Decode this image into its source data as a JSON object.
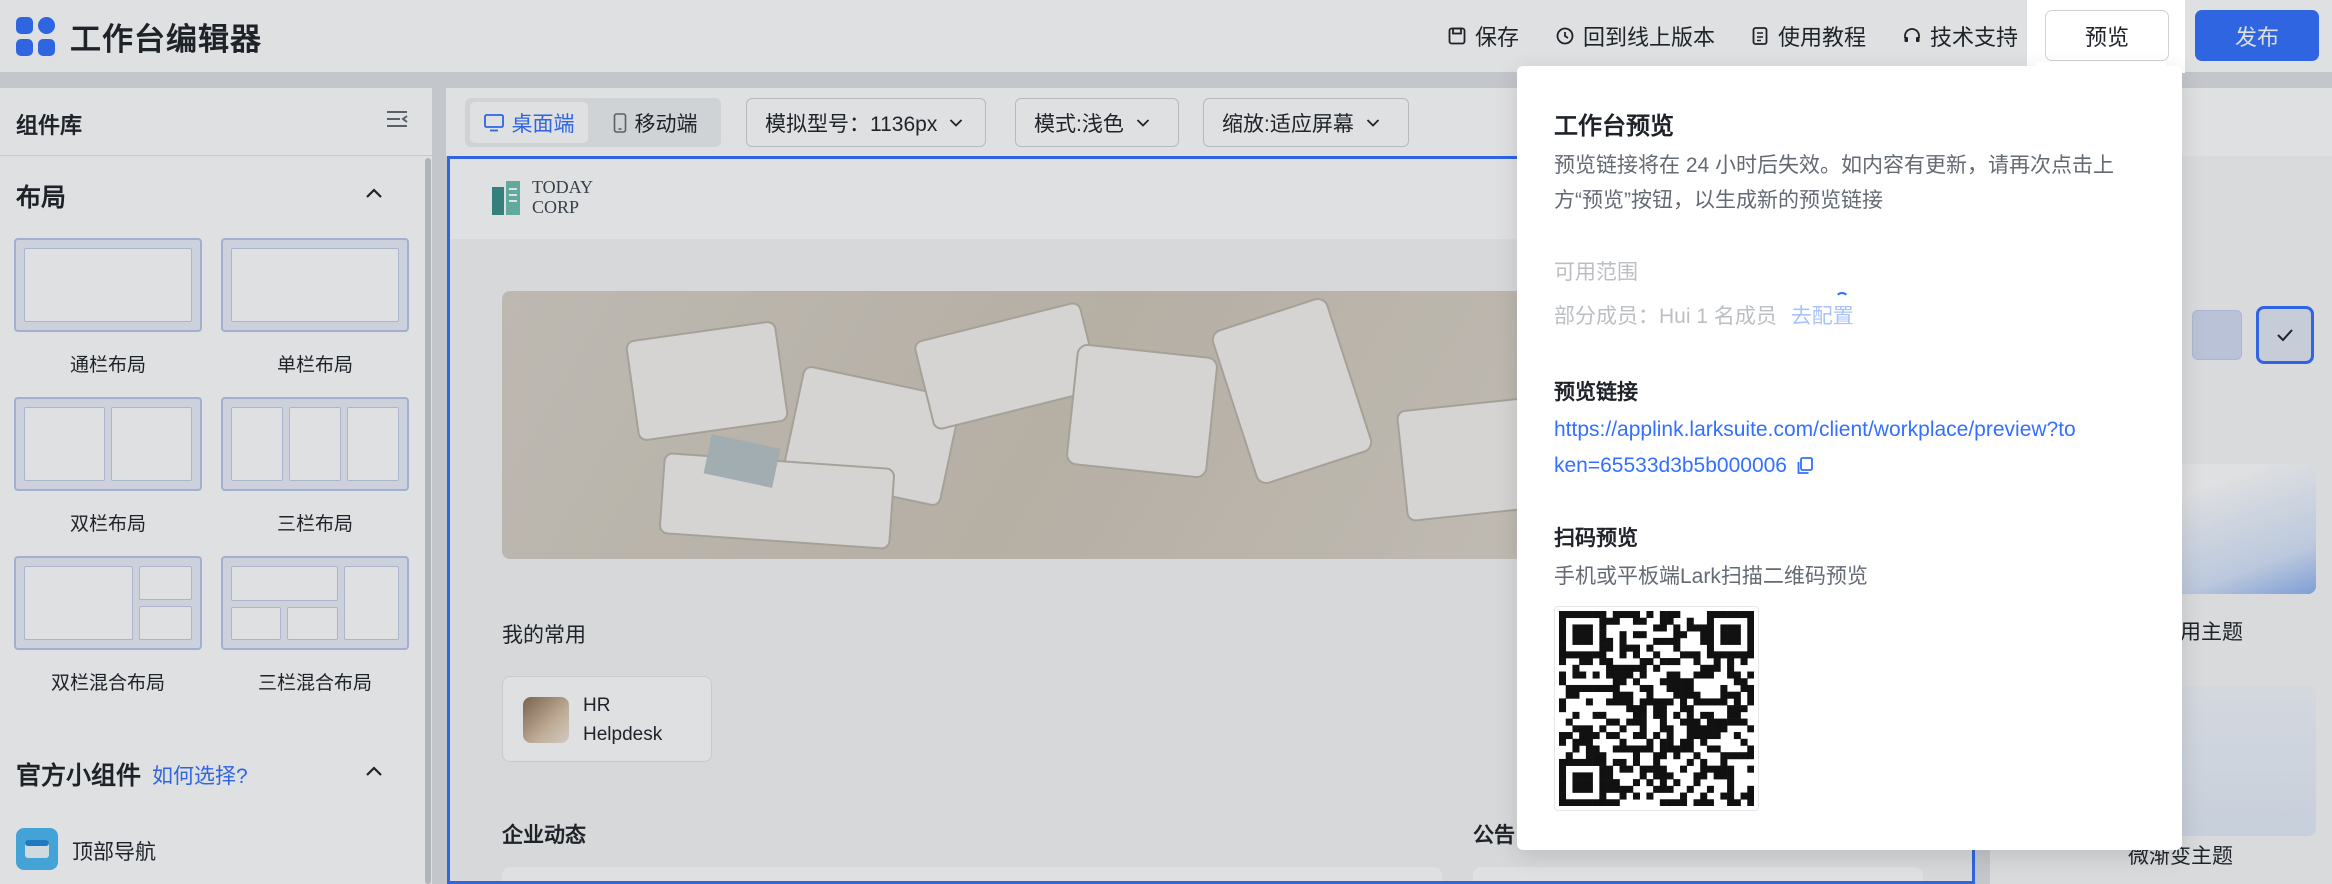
{
  "app": {
    "title": "工作台编辑器"
  },
  "toolbar": {
    "save": "保存",
    "revert": "回到线上版本",
    "tutorial": "使用教程",
    "support": "技术支持",
    "preview": "预览",
    "publish": "发布"
  },
  "left_panel": {
    "title": "组件库",
    "layout_section": "布局",
    "layouts": [
      "通栏布局",
      "单栏布局",
      "双栏布局",
      "三栏布局",
      "双栏混合布局",
      "三栏混合布局"
    ],
    "widgets_section": "官方小组件",
    "widgets_help": "如何选择?",
    "widgets": [
      "顶部导航"
    ]
  },
  "canvas_toolbar": {
    "desktop": "桌面端",
    "mobile": "移动端",
    "model": "模拟型号：1136px",
    "mode": "模式:浅色",
    "zoom": "缩放:适应屏幕"
  },
  "canvas": {
    "logo_line1": "TODAY",
    "logo_line2": "CORP",
    "favorites_title": "我的常用",
    "app_name_1": "HR",
    "app_name_2": "Helpdesk",
    "news_title": "企业动态",
    "notice_title": "公告"
  },
  "right_panel": {
    "theme_1": "用主题",
    "theme_2": "微渐变主题"
  },
  "popover": {
    "title": "工作台预览",
    "desc_line1": "预览链接将在 24 小时后失效。如内容有更新，请再次点击上",
    "desc_line2": "方“预览”按钮，以生成新的预览链接",
    "scope_label": "可用范围",
    "scope_value": "部分成员：Hui 1 名成员",
    "scope_action": "去配置",
    "link_title": "预览链接",
    "link_line1": "https://applink.larksuite.com/client/workplace/preview?to",
    "link_line2": "ken=65533d3b5b000006",
    "qr_title": "扫码预览",
    "qr_desc": "手机或平板端Lark扫描二维码预览"
  },
  "colors": {
    "accent": "#3370ff",
    "text": "#1f2329",
    "muted": "#646a73"
  }
}
